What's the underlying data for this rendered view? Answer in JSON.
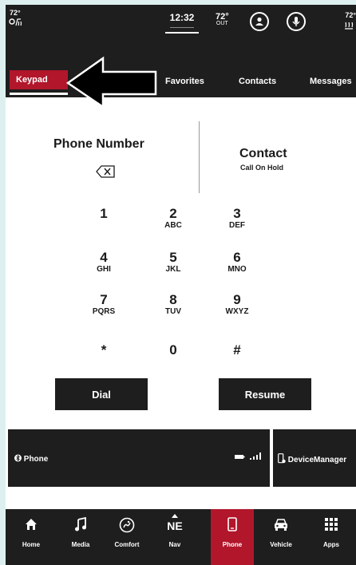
{
  "status": {
    "left_temp": "72°",
    "time": "12:32",
    "out_temp": "72°",
    "out_label": "OUT",
    "right_temp": "72°"
  },
  "tabs": {
    "keypad": "Keypad",
    "favorites": "Favorites",
    "contacts": "Contacts",
    "messages": "Messages"
  },
  "keypad": {
    "phone_title": "Phone Number",
    "contact_title": "Contact",
    "contact_sub": "Call On Hold",
    "keys": [
      {
        "n": "1",
        "l": ""
      },
      {
        "n": "2",
        "l": "ABC"
      },
      {
        "n": "3",
        "l": "DEF"
      },
      {
        "n": "4",
        "l": "GHI"
      },
      {
        "n": "5",
        "l": "JKL"
      },
      {
        "n": "6",
        "l": "MNO"
      },
      {
        "n": "7",
        "l": "PQRS"
      },
      {
        "n": "8",
        "l": "TUV"
      },
      {
        "n": "9",
        "l": "WXYZ"
      },
      {
        "n": "*",
        "l": ""
      },
      {
        "n": "0",
        "l": ""
      },
      {
        "n": "#",
        "l": ""
      }
    ],
    "dial": "Dial",
    "resume": "Resume"
  },
  "device": {
    "phone_label": "Phone",
    "device_manager": "DeviceManager"
  },
  "nav": [
    {
      "label": "Home",
      "icon": "home-icon"
    },
    {
      "label": "Media",
      "icon": "music-icon"
    },
    {
      "label": "Comfort",
      "icon": "comfort-icon"
    },
    {
      "label": "Nav",
      "icon": "compass-icon",
      "heading": "NE"
    },
    {
      "label": "Phone",
      "icon": "phone-icon"
    },
    {
      "label": "Vehicle",
      "icon": "car-icon"
    },
    {
      "label": "Apps",
      "icon": "apps-grid-icon"
    }
  ],
  "colors": {
    "accent": "#b1162b",
    "bar": "#1e1e1e",
    "background": "#ddf0ef"
  }
}
